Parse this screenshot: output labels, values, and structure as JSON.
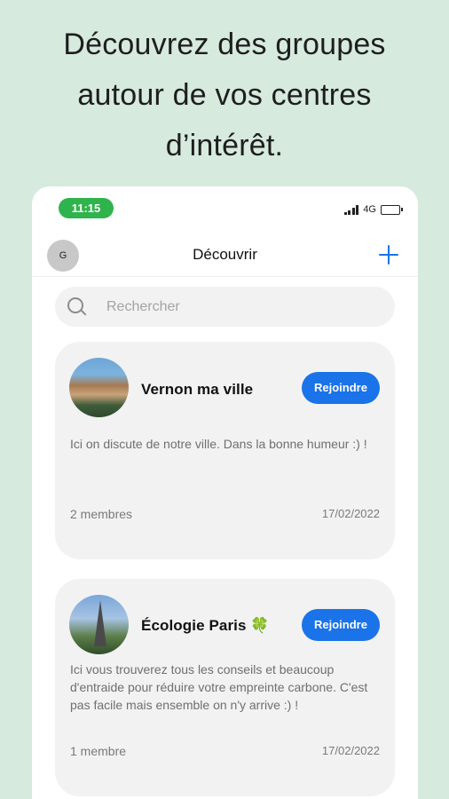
{
  "headline": [
    "Découvrez des groupes",
    "autour de vos centres",
    "d’intérêt."
  ],
  "status_bar": {
    "time": "11:15",
    "network": "4G"
  },
  "nav": {
    "avatar_initial": "G",
    "title": "Découvrir"
  },
  "search": {
    "placeholder": "Rechercher"
  },
  "groups": [
    {
      "name": "Vernon ma ville",
      "description": "Ici on discute de notre ville. Dans la bonne humeur :) !",
      "members": "2 membres",
      "date": "17/02/2022",
      "join_label": "Rejoindre"
    },
    {
      "name": "Écologie Paris 🍀",
      "description": "Ici vous trouverez tous les conseils et beaucoup d'entraide pour réduire votre empreinte carbone. C'est pas facile mais ensemble on n'y arrive :) !",
      "members": "1 membre",
      "date": "17/02/2022",
      "join_label": "Rejoindre"
    }
  ],
  "colors": {
    "background": "#d6eade",
    "accent": "#1a73e8",
    "time_pill": "#2fb34c"
  }
}
